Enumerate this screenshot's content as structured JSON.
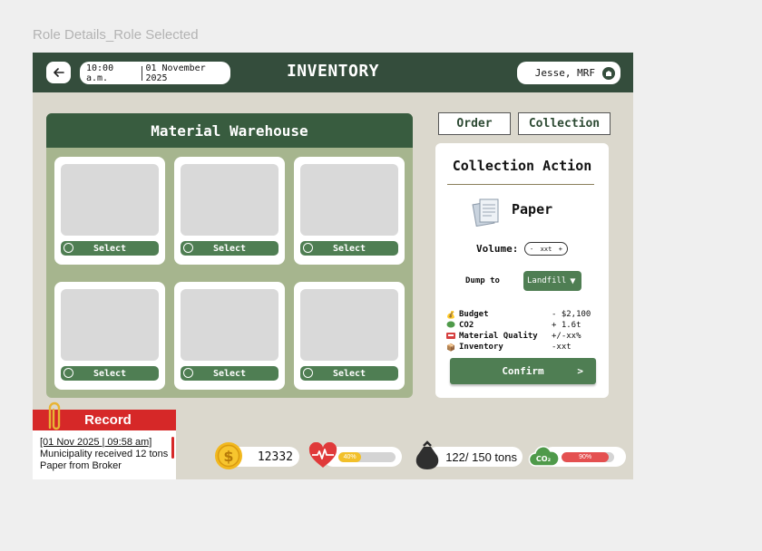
{
  "frame": {
    "title": "Role Details_Role Selected"
  },
  "header": {
    "time": "10:00 a.m.",
    "date": "01 November 2025",
    "title": "INVENTORY",
    "user": "Jesse, MRF"
  },
  "warehouse": {
    "title": "Material Warehouse",
    "cards": [
      {
        "select_label": "Select"
      },
      {
        "select_label": "Select"
      },
      {
        "select_label": "Select"
      },
      {
        "select_label": "Select"
      },
      {
        "select_label": "Select"
      },
      {
        "select_label": "Select"
      }
    ]
  },
  "tabs": {
    "order": "Order",
    "collection": "Collection"
  },
  "panel": {
    "title": "Collection Action",
    "material": "Paper",
    "volume_label": "Volume:",
    "stepper": {
      "minus": "-",
      "value": "xxt",
      "plus": "+"
    },
    "dump_label": "Dump to",
    "dump_value": "Landfill",
    "stats": [
      {
        "icon": "money-bag-icon",
        "label": "Budget",
        "value": "- $2,100"
      },
      {
        "icon": "co2-cloud-icon",
        "label": "CO2",
        "value": "+ 1.6t"
      },
      {
        "icon": "quality-icon",
        "label": "Material Quality",
        "value": "+/-xx%"
      },
      {
        "icon": "box-icon",
        "label": "Inventory",
        "value": "-xxt"
      }
    ],
    "confirm_label": "Confirm",
    "confirm_arrow": ">"
  },
  "record": {
    "title": "Record",
    "date": "[01 Nov 2025 | 09:58 am]",
    "line1": "Municipality received 12 tons",
    "line2": "Paper from Broker"
  },
  "status": {
    "money": "12332",
    "health_percent": "40%",
    "health_value": 0.4,
    "waste": "122/ 150 tons",
    "co2_percent": "90%",
    "co2_value": 0.9
  },
  "colors": {
    "header_green": "#344d3c",
    "button_green": "#4f7e53",
    "warehouse_bg": "#a6b58e",
    "record_red": "#d62828",
    "app_bg": "#dbd8cd"
  }
}
